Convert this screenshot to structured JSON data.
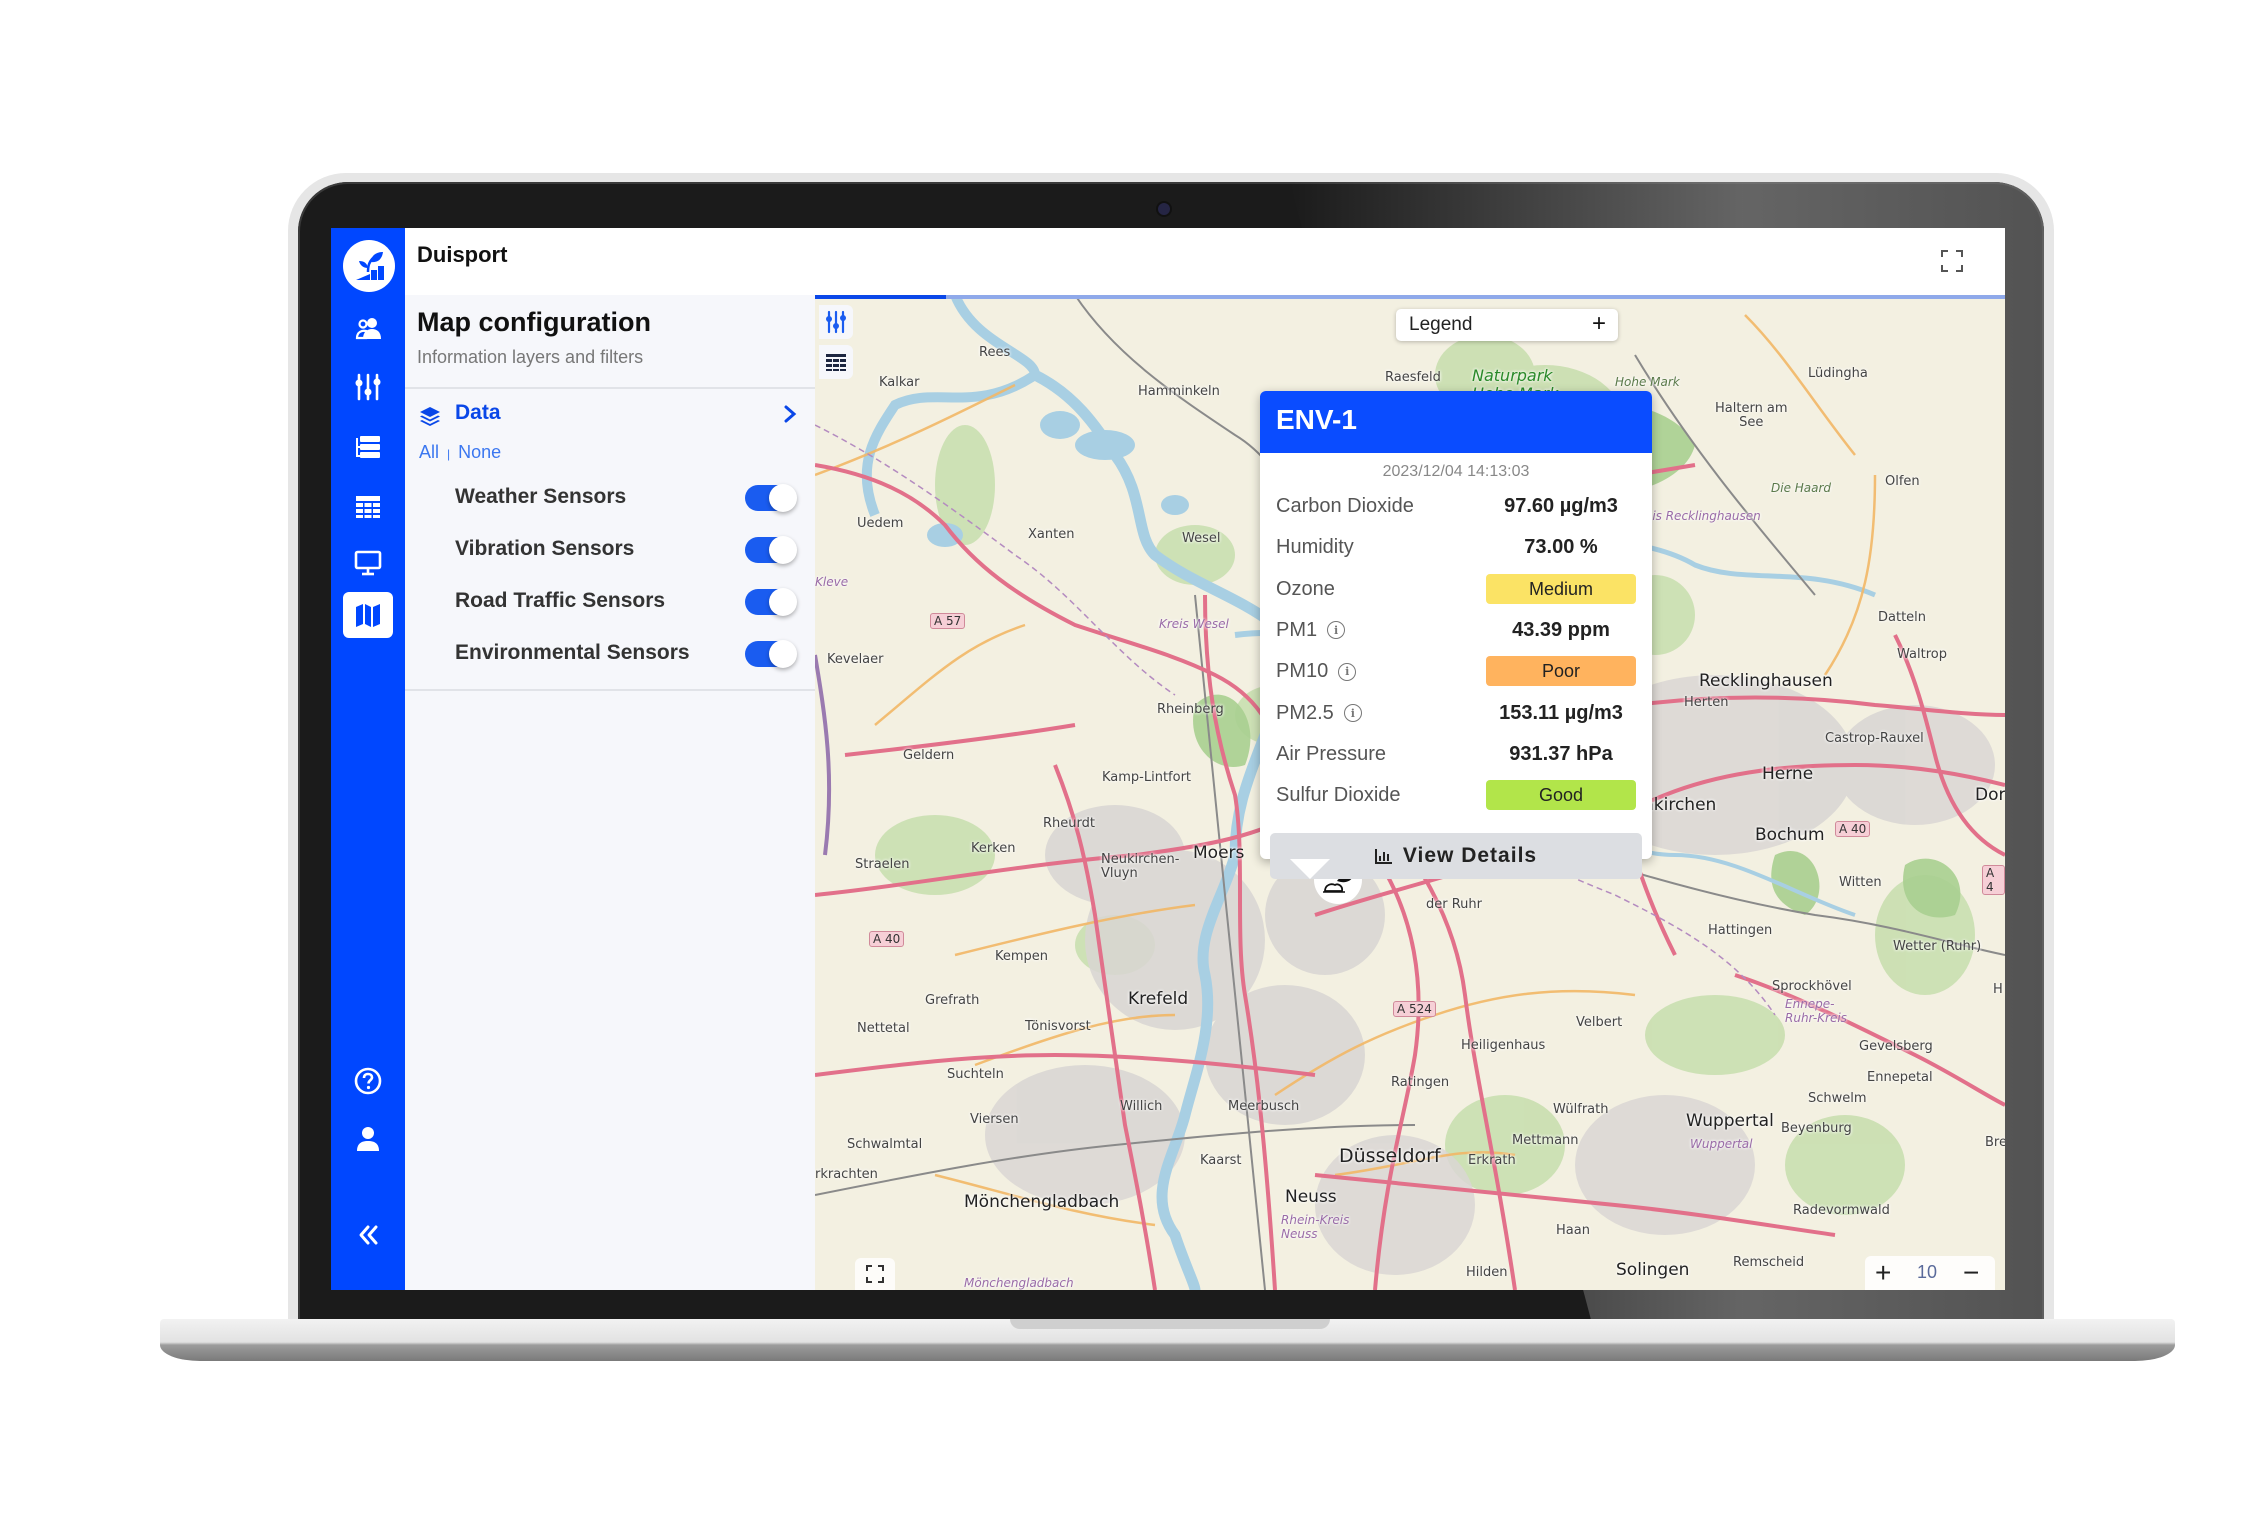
{
  "app": {
    "title": "Duisport"
  },
  "sidebar": {
    "items": [
      {
        "name": "users",
        "icon": "users-icon"
      },
      {
        "name": "controls",
        "icon": "sliders-icon"
      },
      {
        "name": "list",
        "icon": "list-icon"
      },
      {
        "name": "table",
        "icon": "table-icon"
      },
      {
        "name": "monitor",
        "icon": "monitor-icon"
      },
      {
        "name": "map",
        "icon": "map-icon",
        "active": true
      }
    ],
    "bottom": [
      {
        "name": "help",
        "icon": "help-icon"
      },
      {
        "name": "profile",
        "icon": "user-icon"
      },
      {
        "name": "collapse",
        "icon": "double-chevron-left-icon"
      }
    ]
  },
  "config": {
    "title": "Map configuration",
    "subtitle": "Information layers and filters",
    "data_label": "Data",
    "all_label": "All",
    "none_label": "None",
    "sensors": [
      {
        "label": "Weather Sensors",
        "enabled": true
      },
      {
        "label": "Vibration Sensors",
        "enabled": true
      },
      {
        "label": "Road Traffic Sensors",
        "enabled": true
      },
      {
        "label": "Environmental Sensors",
        "enabled": true
      }
    ]
  },
  "map": {
    "loading_progress": 0.11,
    "legend_label": "Legend",
    "legend_toggle": "+",
    "zoom_level": "10",
    "zoom_in": "+",
    "zoom_out": "−",
    "labels": {
      "kalkar": "Kalkar",
      "rees": "Rees",
      "hamminkeln": "Hamminkeln",
      "uedem": "Uedem",
      "xanten": "Xanten",
      "wesel": "Wesel",
      "kleve": "Kleve",
      "kreis_wesel": "Kreis Wesel",
      "kevelaer": "Kevelaer",
      "rheinberg": "Rheinberg",
      "geldern": "Geldern",
      "kamp_lintfort": "Kamp-Lintfort",
      "rheurdt": "Rheurdt",
      "kerken": "Kerken",
      "neukirchen": "Neukirchen-\nVluyn",
      "moers": "Moers",
      "straelen": "Straelen",
      "kempen": "Kempen",
      "krefeld": "Krefeld",
      "grefrath": "Grefrath",
      "tonisvorst": "Tönisvorst",
      "nettetal": "Nettetal",
      "suchteln": "Suchteln",
      "willich": "Willich",
      "viersen": "Viersen",
      "schwalmtal": "Schwalmtal",
      "meerbusch": "Meerbusch",
      "kaarst": "Kaarst",
      "moenchengladbach": "Mönchengladbach",
      "moenchengladbach_region": "Mönchengladbach",
      "neuss": "Neuss",
      "rhein_kreis": "Rhein-Kreis\nNeuss",
      "duesseldorf": "Düsseldorf",
      "erkrath": "Erkrath",
      "ratingen": "Ratingen",
      "heiligenhaus": "Heiligenhaus",
      "velbert": "Velbert",
      "wuelfrath": "Wülfrath",
      "mettmann": "Mettmann",
      "haan": "Haan",
      "hilden": "Hilden",
      "solingen": "Solingen",
      "remscheid": "Remscheid",
      "wuppertal": "Wuppertal",
      "wuppertal_region": "Wuppertal",
      "radevormwald": "Radevormwald",
      "schwelm": "Schwelm",
      "beyenburg": "Beyenburg",
      "ennepetal": "Ennepetal",
      "gevelsberg": "Gevelsberg",
      "sprockhovel": "Sprockhövel",
      "ennepe_ruhr": "Ennepe-\nRuhr-Kreis",
      "hattingen": "Hattingen",
      "witten": "Witten",
      "wetter": "Wetter (Ruhr)",
      "bochum": "Bochum",
      "herne": "Herne",
      "castrop": "Castrop-Rauxel",
      "gelsenkirchen": "nkirchen",
      "dortmund": "Dort",
      "herten": "Herten",
      "recklinghausen": "Recklinghausen",
      "waltrop": "Waltrop",
      "datteln": "Datteln",
      "olfen": "Olfen",
      "die_haard": "Die Haard",
      "kreis_recklinghausen": "reis Recklinghausen",
      "haltern": "Haltern am\nSee",
      "luedinghausen": "Lüdingha",
      "raesfeld": "Raesfeld",
      "naturpark": "Naturpark\nHohe Mark",
      "hohe_mark": "Hohe Mark",
      "der_ruhr": "der Ruhr",
      "erkrachten": "rkrachten",
      "brec": "Brec",
      "h": "H",
      "a57": "A 57",
      "a40_w": "A 40",
      "a40_e": "A 40",
      "a524": "A 524",
      "a4": "A 4"
    }
  },
  "popup": {
    "title": "ENV-1",
    "timestamp": "2023/12/04 14:13:03",
    "metrics": [
      {
        "label": "Carbon Dioxide",
        "value": "97.60 µg/m3",
        "info": false
      },
      {
        "label": "Humidity",
        "value": "73.00 %",
        "info": false
      },
      {
        "label": "Ozone",
        "badge": "Medium",
        "color": "#fbe365",
        "info": false
      },
      {
        "label": "PM1",
        "value": "43.39 ppm",
        "info": true
      },
      {
        "label": "PM10",
        "badge": "Poor",
        "color": "#ffb35e",
        "info": true
      },
      {
        "label": "PM2.5",
        "value": "153.11 µg/m3",
        "info": true
      },
      {
        "label": "Air Pressure",
        "value": "931.37 hPa",
        "info": false
      },
      {
        "label": "Sulfur Dioxide",
        "badge": "Good",
        "color": "#b2e54a",
        "info": false
      }
    ],
    "view_details_label": "View Details"
  },
  "colors": {
    "brand": "#0047ff",
    "accent": "#0a47e8",
    "toggle_on": "#1a5cf0"
  }
}
